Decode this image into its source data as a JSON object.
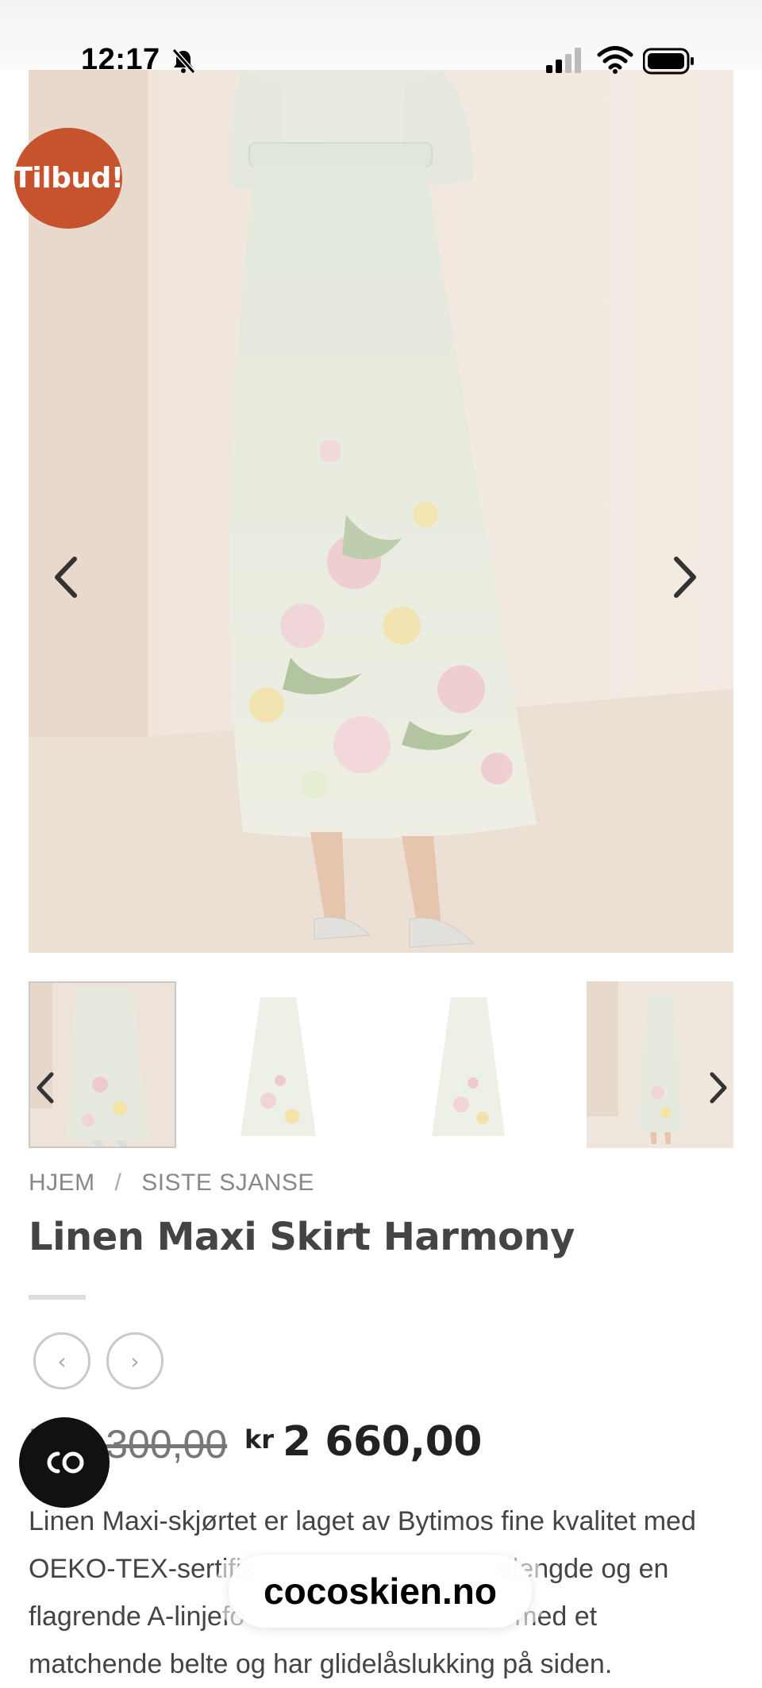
{
  "status_bar": {
    "time": "12:17",
    "icons": [
      "bell-muted-icon",
      "signal-icon",
      "wifi-icon",
      "battery-icon"
    ]
  },
  "product": {
    "badge": "Tilbud!",
    "title": "Linen Maxi Skirt Harmony",
    "old_price": "kr 3 300,00",
    "currency": "kr",
    "new_price": "2 660,00",
    "description_lines": [
      "Linen Maxi-skjørtet er laget av Bytimos fine kvalitet med",
      "OEKO-TEX-sertifis",
      "xilengde og en",
      "flagrende A-linjefo",
      "med et",
      "matchende belte og har glidelåslukking på siden."
    ]
  },
  "breadcrumb": {
    "items": [
      "HJEM",
      "SISTE SJANSE"
    ],
    "separator": "/"
  },
  "gallery": {
    "thumbnail_count": 4,
    "prev_icon": "chevron-left-icon",
    "next_icon": "chevron-right-icon"
  },
  "nav": {
    "prev_product": "‹",
    "next_product": "›"
  },
  "browser": {
    "url": "cocoskien.no"
  },
  "colors": {
    "badge": "#c6532e",
    "chat_button": "#111111",
    "text": "#444444"
  }
}
